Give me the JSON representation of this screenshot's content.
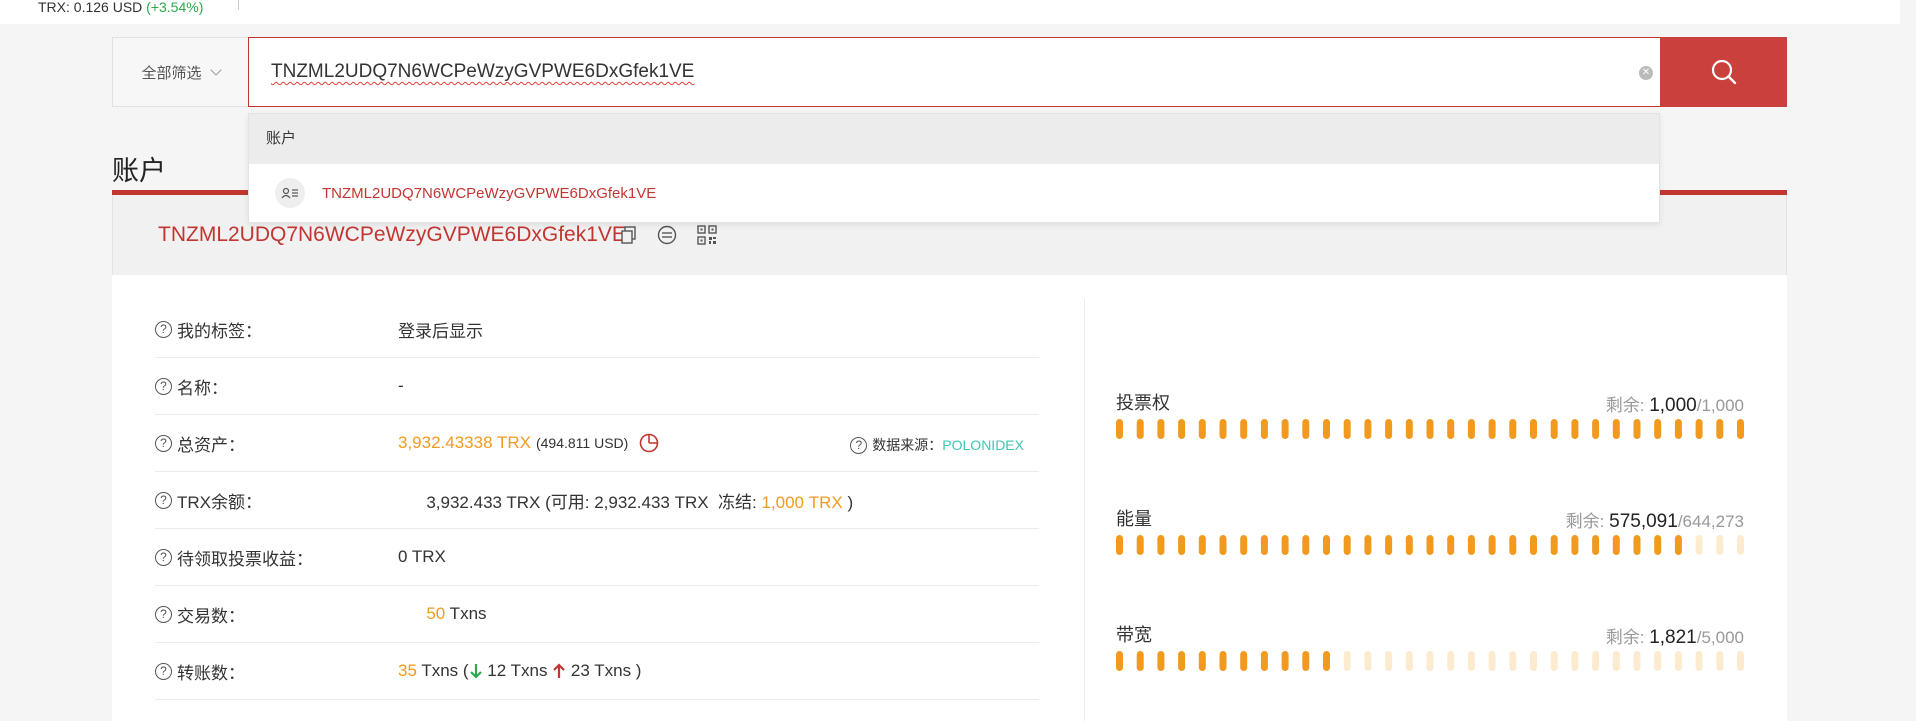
{
  "ticker": {
    "label": "TRX: 0.126 USD",
    "change": "(+3.54%)"
  },
  "search": {
    "filter_label": "全部筛选",
    "value": "TNZML2UDQ7N6WCPeWzyGVPWE6DxGfek1VE",
    "dropdown_header": "账户",
    "dropdown_item": "TNZML2UDQ7N6WCPeWzyGVPWE6DxGfek1VE"
  },
  "section_title": "账户",
  "address": "TNZML2UDQ7N6WCPeWzyGVPWE6DxGfek1VE",
  "info": {
    "tag_label": "我的标签：",
    "tag_value": "登录后显示",
    "name_label": "名称：",
    "name_value": "-",
    "total_label": "总资产：",
    "total_value": "3,932.43338 TRX",
    "total_usd": "(494.811 USD)",
    "datasource_label": "数据来源：",
    "datasource_value": "POLONIDEX",
    "balance_label": "TRX余额：",
    "balance_main": "3,932.433 TRX (可用: 2,932.433 TRX  冻结: ",
    "balance_frozen": "1,000 TRX",
    "balance_close": " )",
    "reward_label": "待领取投票收益：",
    "reward_value": "0 TRX",
    "tx_label": "交易数：",
    "tx_count": "50",
    "tx_unit": " Txns",
    "transfer_label": "转账数：",
    "transfer_count": "35",
    "transfer_unit": " Txns (",
    "transfer_in": " 12 Txns ",
    "transfer_out": " 23 Txns )"
  },
  "resources": [
    {
      "name": "投票权",
      "remain_label": "剩余: ",
      "current": "1,000",
      "total": "/1,000",
      "fill": 1.0
    },
    {
      "name": "能量",
      "remain_label": "剩余: ",
      "current": "575,091",
      "total": "/644,273",
      "fill": 0.8927
    },
    {
      "name": "带宽",
      "remain_label": "剩余: ",
      "current": "1,821",
      "total": "/5,000",
      "fill": 0.3642
    }
  ],
  "colors": {
    "accent": "#c23631",
    "orange": "#f29a1f",
    "orange_light": "#fdebd0",
    "teal": "#3fc6b2",
    "green": "#2fa84f"
  }
}
